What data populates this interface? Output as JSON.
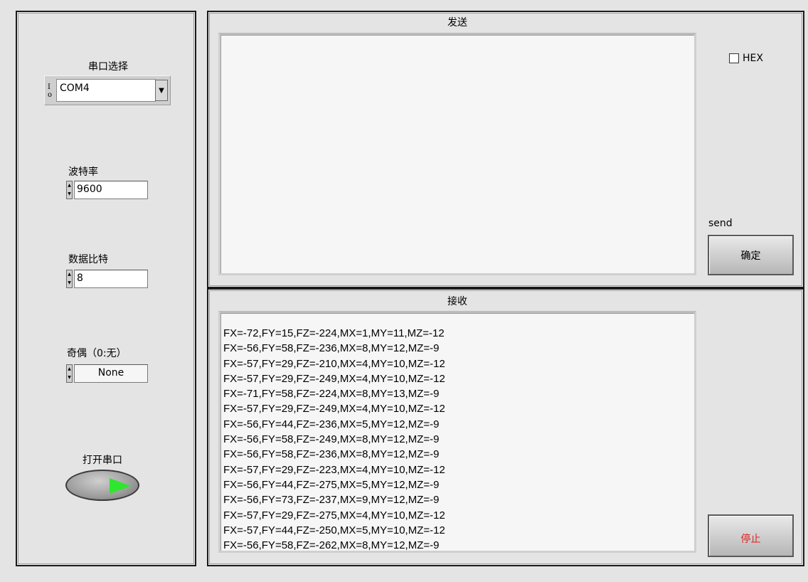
{
  "left_panel": {
    "port_label": "串口选择",
    "port_io_symbol": "I/o",
    "port_value": "COM4",
    "baud_label": "波特率",
    "baud_value": "9600",
    "databits_label": "数据比特",
    "databits_value": "8",
    "parity_label": "奇偶（0:无）",
    "parity_value": "None",
    "open_label": "打开串口"
  },
  "send_panel": {
    "title": "发送",
    "text": "",
    "hex_label": "HEX",
    "hex_checked": false,
    "send_label": "send",
    "confirm_button": "确定"
  },
  "recv_panel": {
    "title": "接收",
    "lines": [
      "FX=-72,FY=15,FZ=-224,MX=1,MY=11,MZ=-12",
      "FX=-56,FY=58,FZ=-236,MX=8,MY=12,MZ=-9",
      "FX=-57,FY=29,FZ=-210,MX=4,MY=10,MZ=-12",
      "FX=-57,FY=29,FZ=-249,MX=4,MY=10,MZ=-12",
      "FX=-71,FY=58,FZ=-224,MX=8,MY=13,MZ=-9",
      "FX=-57,FY=29,FZ=-249,MX=4,MY=10,MZ=-12",
      "FX=-56,FY=44,FZ=-236,MX=5,MY=12,MZ=-9",
      "FX=-56,FY=58,FZ=-249,MX=8,MY=12,MZ=-9",
      "FX=-56,FY=58,FZ=-236,MX=8,MY=12,MZ=-9",
      "FX=-57,FY=29,FZ=-223,MX=4,MY=10,MZ=-12",
      "FX=-56,FY=44,FZ=-275,MX=5,MY=12,MZ=-9",
      "FX=-56,FY=73,FZ=-237,MX=9,MY=12,MZ=-9",
      "FX=-57,FY=29,FZ=-275,MX=4,MY=10,MZ=-12",
      "FX=-57,FY=44,FZ=-250,MX=5,MY=10,MZ=-12",
      "FX=-56,FY=58,FZ=-262,MX=8,MY=12,MZ=-9"
    ],
    "stop_button": "停止",
    "stop_color": "#e02020"
  }
}
